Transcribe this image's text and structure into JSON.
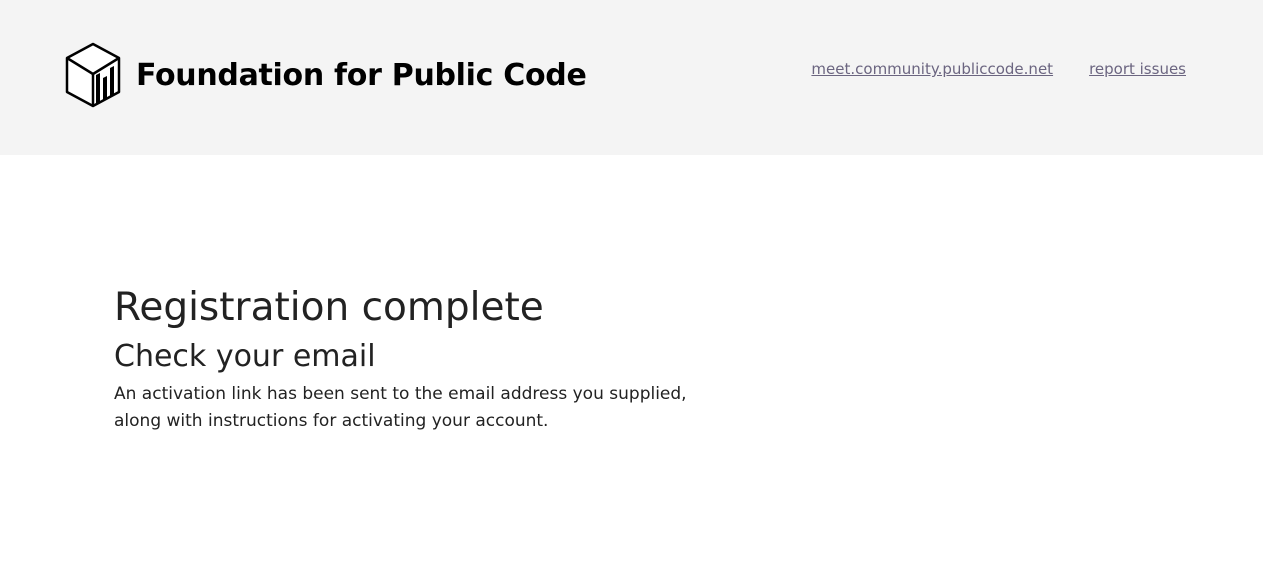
{
  "header": {
    "logo_icon": "cube-bar-chart-logo-icon",
    "brand_name": "Foundation for Public Code",
    "nav": [
      {
        "label": "meet.community.publiccode.net"
      },
      {
        "label": "report issues"
      }
    ]
  },
  "main": {
    "title": "Registration complete",
    "subtitle": "Check your email",
    "message": "An activation link has been sent to the email address you supplied, along with instructions for activating your account."
  },
  "colors": {
    "header_bg": "#f4f4f4",
    "link": "#6b6580",
    "text": "#222222"
  }
}
